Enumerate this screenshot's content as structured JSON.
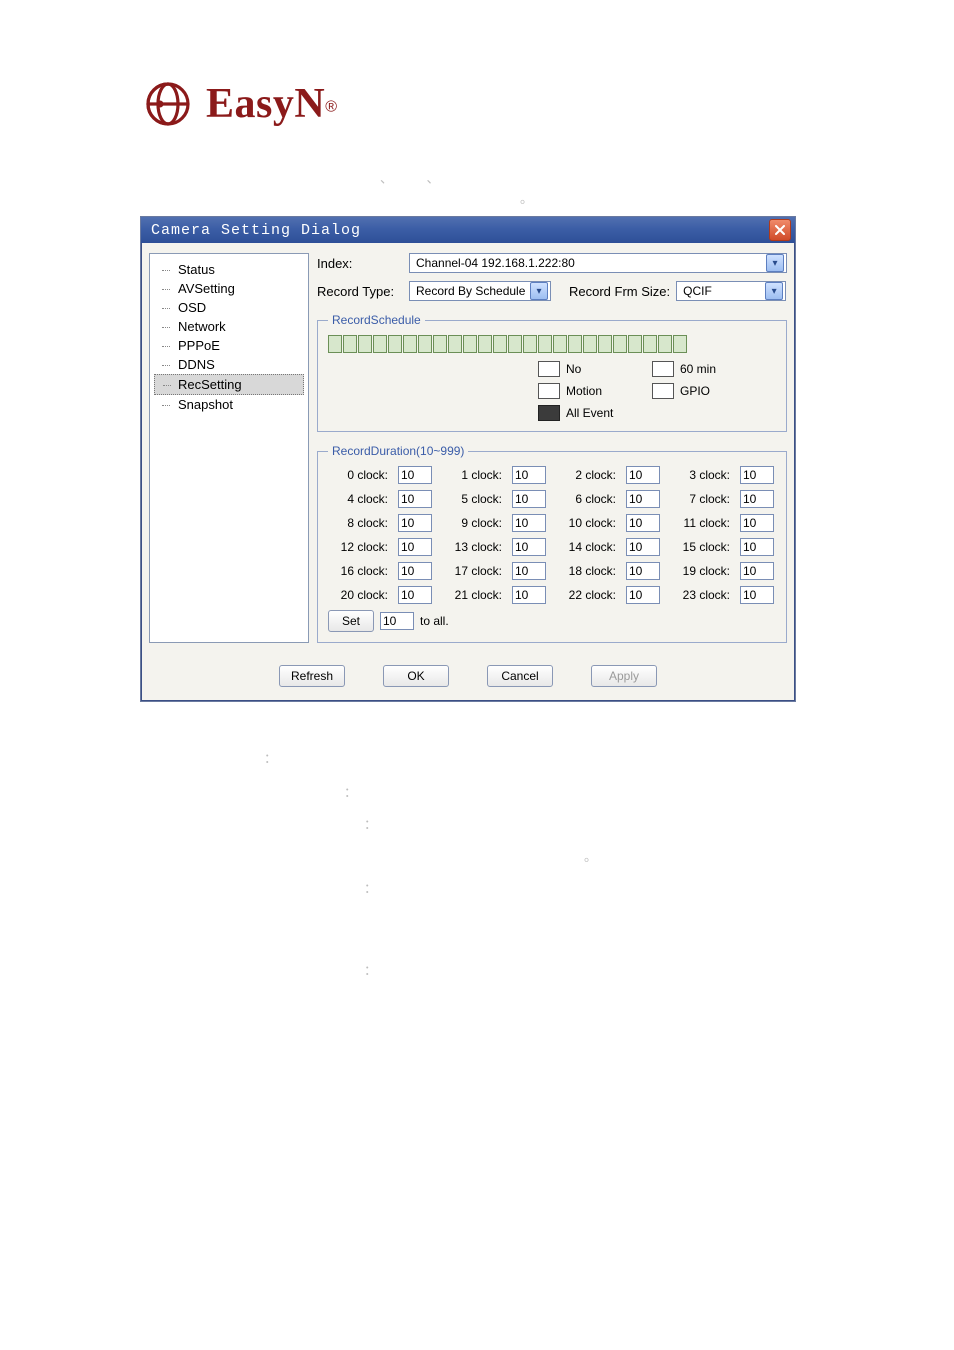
{
  "logo": {
    "text": "EasyN",
    "registered": "®"
  },
  "dialog": {
    "title": "Camera Setting Dialog",
    "tree": [
      {
        "label": "Status"
      },
      {
        "label": "AVSetting"
      },
      {
        "label": "OSD"
      },
      {
        "label": "Network"
      },
      {
        "label": "PPPoE"
      },
      {
        "label": "DDNS"
      },
      {
        "label": "RecSetting",
        "selected": true
      },
      {
        "label": "Snapshot"
      }
    ],
    "index_label": "Index:",
    "index_value": "Channel-04    192.168.1.222:80",
    "record_type_label": "Record Type:",
    "record_type_value": "Record By Schedule",
    "record_frm_size_label": "Record Frm Size:",
    "record_frm_size_value": "QCIF",
    "schedule": {
      "group_label": "RecordSchedule",
      "legend": [
        {
          "swatch": "white",
          "label": "No"
        },
        {
          "swatch": "white",
          "label": "60 min"
        },
        {
          "swatch": "white",
          "label": "Motion"
        },
        {
          "swatch": "white",
          "label": "GPIO"
        },
        {
          "swatch": "dark",
          "label": "All Event"
        }
      ]
    },
    "duration": {
      "group_label": "RecordDuration(10~999)",
      "labels": [
        "0 clock:",
        "1 clock:",
        "2 clock:",
        "3 clock:",
        "4 clock:",
        "5 clock:",
        "6 clock:",
        "7 clock:",
        "8 clock:",
        "9 clock:",
        "10 clock:",
        "11 clock:",
        "12 clock:",
        "13 clock:",
        "14 clock:",
        "15 clock:",
        "16 clock:",
        "17 clock:",
        "18 clock:",
        "19 clock:",
        "20 clock:",
        "21 clock:",
        "22 clock:",
        "23 clock:"
      ],
      "values": [
        "10",
        "10",
        "10",
        "10",
        "10",
        "10",
        "10",
        "10",
        "10",
        "10",
        "10",
        "10",
        "10",
        "10",
        "10",
        "10",
        "10",
        "10",
        "10",
        "10",
        "10",
        "10",
        "10",
        "10"
      ],
      "set_btn": "Set",
      "set_value": "10",
      "to_all": "to all."
    },
    "buttons": {
      "refresh": "Refresh",
      "ok": "OK",
      "cancel": "Cancel",
      "apply": "Apply"
    }
  },
  "descr_marks": {
    "colon": "：",
    "dot": "。",
    "backtick": "、"
  }
}
